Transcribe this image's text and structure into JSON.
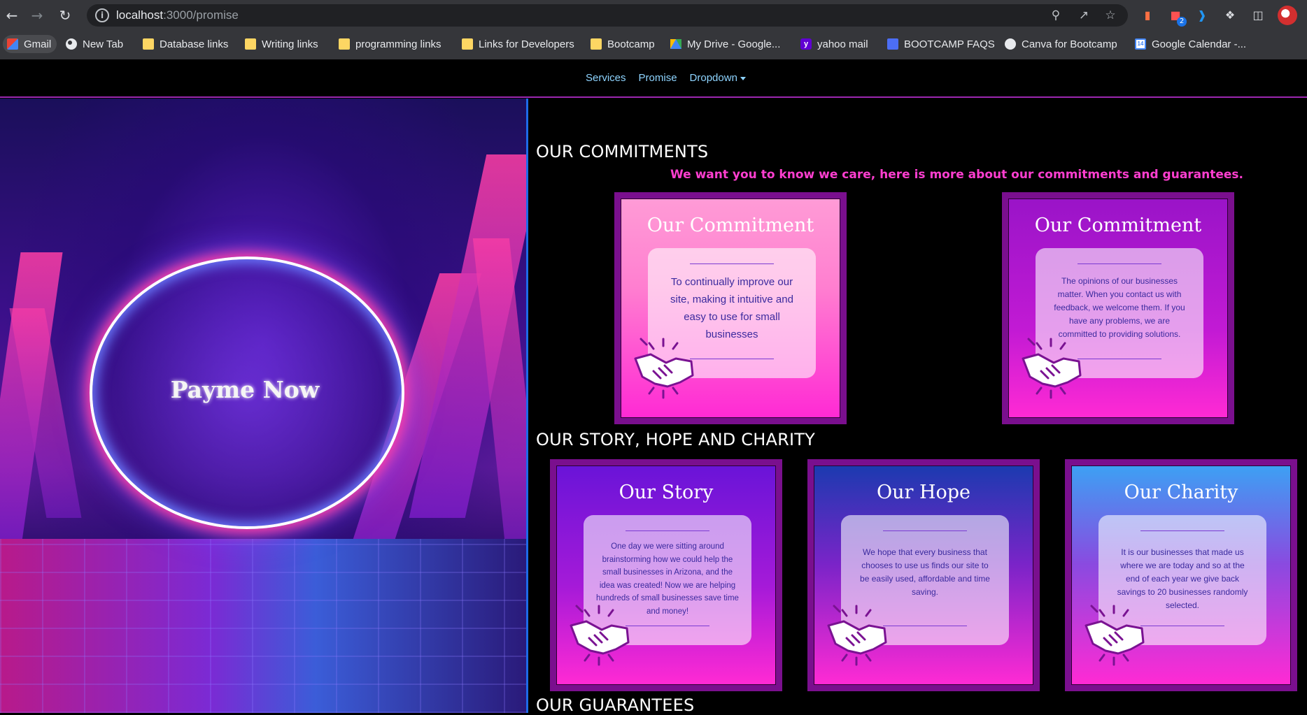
{
  "browser": {
    "url_host": "localhost",
    "url_path": ":3000/promise",
    "extension_badge": "2",
    "bookmarks": [
      {
        "label": "Gmail",
        "icon": "gmail-icon"
      },
      {
        "label": "New Tab",
        "icon": "globe-icon"
      },
      {
        "label": "Database links",
        "icon": "folder-icon"
      },
      {
        "label": "Writing links",
        "icon": "folder-icon"
      },
      {
        "label": "programming links",
        "icon": "folder-icon"
      },
      {
        "label": "Links for Developers",
        "icon": "folder-icon"
      },
      {
        "label": "Bootcamp",
        "icon": "folder-icon"
      },
      {
        "label": "My Drive - Google...",
        "icon": "drive-icon"
      },
      {
        "label": "yahoo mail",
        "icon": "yahoo-icon"
      },
      {
        "label": "BOOTCAMP FAQS",
        "icon": "faq-icon"
      },
      {
        "label": "Canva for Bootcamp",
        "icon": "globe-icon"
      },
      {
        "label": "Google Calendar -...",
        "icon": "calendar-icon"
      }
    ]
  },
  "nav": {
    "services": "Services",
    "promise": "Promise",
    "dropdown": "Dropdown"
  },
  "hero": {
    "title": "Payme Now"
  },
  "commitments": {
    "heading": "OUR COMMITMENTS",
    "tagline": "We want you to know we care, here is more about our commitments and guarantees.",
    "cards": [
      {
        "title": "Our Commitment",
        "text": "To continually improve our site, making it intuitive and easy to use for small businesses"
      },
      {
        "title": "Our Commitment",
        "text": "The opinions of our businesses matter. When you contact us with feedback, we welcome them. If you have any problems, we are committed to providing solutions."
      }
    ]
  },
  "story": {
    "heading": "OUR STORY, HOPE AND CHARITY",
    "cards": [
      {
        "title": "Our Story",
        "text": "One day we were sitting around brainstorming how we could help the small businesses in Arizona, and the idea was created! Now we are helping hundreds of small businesses save time and money!"
      },
      {
        "title": "Our Hope",
        "text": "We hope that every business that chooses to use us finds our site to be easily used, affordable and time saving."
      },
      {
        "title": "Our Charity",
        "text": "It is our businesses that made us where we are today and so at the end of each year we give back savings to 20 businesses randomly selected."
      }
    ]
  },
  "guarantees": {
    "heading": "OUR GUARANTEES"
  },
  "colors": {
    "accent_pink": "#ff3ed0",
    "frame_purple": "#7a0f8e",
    "nav_link": "#8ed4ff",
    "divider_blue": "#1e6be8"
  }
}
